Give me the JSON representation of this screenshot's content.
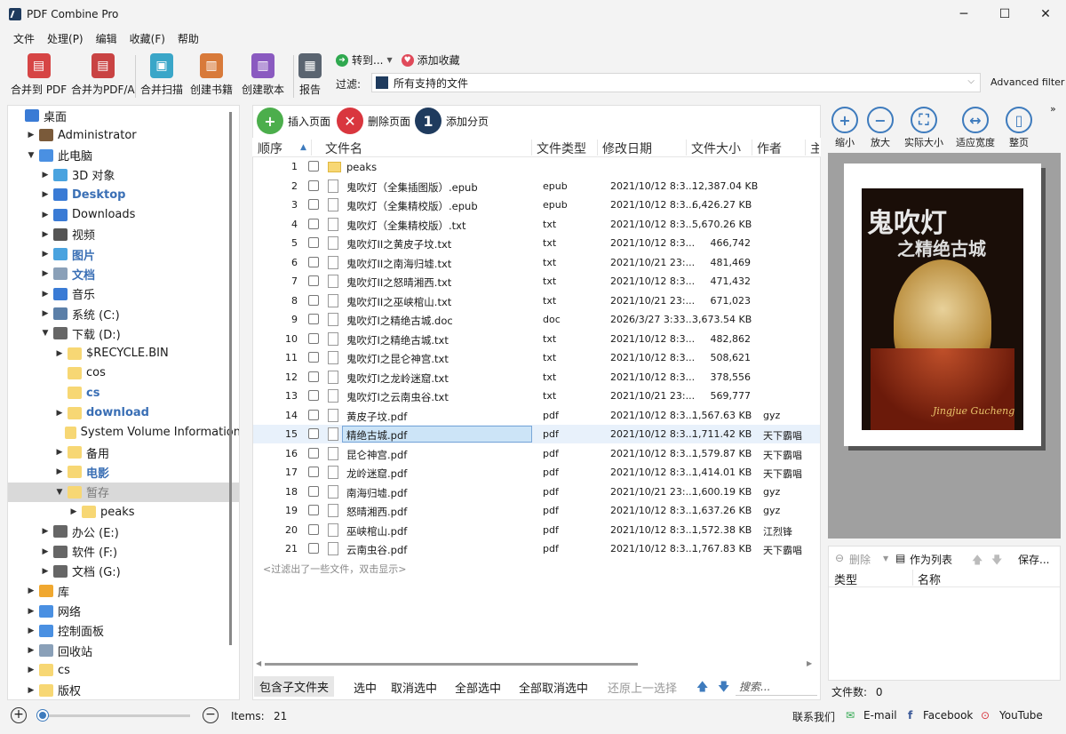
{
  "window": {
    "title": "PDF Combine Pro",
    "min": "─",
    "max": "☐",
    "close": "✕"
  },
  "menu": [
    "文件",
    "处理(P)",
    "编辑",
    "收藏(F)",
    "帮助"
  ],
  "toolbar": {
    "buttons": [
      "合并到 PDF",
      "合并为PDF/A",
      "合并扫描",
      "创建书籍",
      "创建歌本",
      "报告"
    ],
    "goto_label": "转到...",
    "favorite_label": "添加收藏",
    "filter_label": "过滤:",
    "filter_value": "所有支持的文件",
    "advanced_filter": "Advanced filter"
  },
  "tree": [
    {
      "label": "桌面",
      "level": 0,
      "twisty": "",
      "icon": "#3a7bd5"
    },
    {
      "label": "Administrator",
      "level": 1,
      "twisty": "▶",
      "icon": "#7a5a3a"
    },
    {
      "label": "此电脑",
      "level": 1,
      "twisty": "▼",
      "icon": "#4a90e2"
    },
    {
      "label": "3D 对象",
      "level": 2,
      "twisty": "▶",
      "icon": "#4aa3df"
    },
    {
      "label": "Desktop",
      "level": 2,
      "twisty": "▶",
      "icon": "#3a7bd5",
      "bold": true
    },
    {
      "label": "Downloads",
      "level": 2,
      "twisty": "▶",
      "icon": "#3a7bd5"
    },
    {
      "label": "视频",
      "level": 2,
      "twisty": "▶",
      "icon": "#555555"
    },
    {
      "label": "图片",
      "level": 2,
      "twisty": "▶",
      "icon": "#4aa3df",
      "bold": true
    },
    {
      "label": "文档",
      "level": 2,
      "twisty": "▶",
      "icon": "#8aa0b8",
      "bold": true
    },
    {
      "label": "音乐",
      "level": 2,
      "twisty": "▶",
      "icon": "#3a7bd5"
    },
    {
      "label": "系统 (C:)",
      "level": 2,
      "twisty": "▶",
      "icon": "#5b7fa8"
    },
    {
      "label": "下载 (D:)",
      "level": 2,
      "twisty": "▼",
      "icon": "#666666"
    },
    {
      "label": "$RECYCLE.BIN",
      "level": 3,
      "twisty": "▶",
      "icon": "#f7d774"
    },
    {
      "label": "cos",
      "level": 3,
      "twisty": "",
      "icon": "#f7d774"
    },
    {
      "label": "cs",
      "level": 3,
      "twisty": "",
      "icon": "#f7d774",
      "bold": true
    },
    {
      "label": "download",
      "level": 3,
      "twisty": "▶",
      "icon": "#f7d774",
      "bold": true
    },
    {
      "label": "System Volume Information",
      "level": 3,
      "twisty": "",
      "icon": "#f7d774"
    },
    {
      "label": "备用",
      "level": 3,
      "twisty": "▶",
      "icon": "#f7d774"
    },
    {
      "label": "电影",
      "level": 3,
      "twisty": "▶",
      "icon": "#f7d774",
      "bold": true
    },
    {
      "label": "暂存",
      "level": 3,
      "twisty": "▼",
      "icon": "#f7d774",
      "selected": true
    },
    {
      "label": "peaks",
      "level": 4,
      "twisty": "▶",
      "icon": "#f7d774"
    },
    {
      "label": "办公 (E:)",
      "level": 2,
      "twisty": "▶",
      "icon": "#666666"
    },
    {
      "label": "软件 (F:)",
      "level": 2,
      "twisty": "▶",
      "icon": "#666666"
    },
    {
      "label": "文档 (G:)",
      "level": 2,
      "twisty": "▶",
      "icon": "#666666"
    },
    {
      "label": "库",
      "level": 1,
      "twisty": "▶",
      "icon": "#f0a830"
    },
    {
      "label": "网络",
      "level": 1,
      "twisty": "▶",
      "icon": "#4a90e2"
    },
    {
      "label": "控制面板",
      "level": 1,
      "twisty": "▶",
      "icon": "#4a90e2"
    },
    {
      "label": "回收站",
      "level": 1,
      "twisty": "▶",
      "icon": "#8aa0b8"
    },
    {
      "label": "cs",
      "level": 1,
      "twisty": "▶",
      "icon": "#f7d774"
    },
    {
      "label": "版权",
      "level": 1,
      "twisty": "▶",
      "icon": "#f7d774"
    }
  ],
  "page_buttons": {
    "insert": "插入页面",
    "delete": "删除页面",
    "add_section": "添加分页"
  },
  "columns": [
    "顺序",
    "文件名",
    "文件类型",
    "修改日期",
    "文件大小",
    "作者",
    "主"
  ],
  "files": [
    {
      "n": "1",
      "name": "peaks",
      "type": "",
      "date": "",
      "size": "",
      "author": "",
      "folder": true
    },
    {
      "n": "2",
      "name": "鬼吹灯（全集插图版）.epub",
      "type": "epub",
      "date": "2021/10/12 8:3...",
      "size": "12,387.04 KB",
      "author": ""
    },
    {
      "n": "3",
      "name": "鬼吹灯（全集精校版）.epub",
      "type": "epub",
      "date": "2021/10/12 8:3...",
      "size": "6,426.27 KB",
      "author": ""
    },
    {
      "n": "4",
      "name": "鬼吹灯（全集精校版）.txt",
      "type": "txt",
      "date": "2021/10/12 8:3...",
      "size": "5,670.26 KB",
      "author": ""
    },
    {
      "n": "5",
      "name": "鬼吹灯II之黄皮子坟.txt",
      "type": "txt",
      "date": "2021/10/12 8:3...",
      "size": "466,742",
      "author": ""
    },
    {
      "n": "6",
      "name": "鬼吹灯II之南海归墟.txt",
      "type": "txt",
      "date": "2021/10/21 23:...",
      "size": "481,469",
      "author": ""
    },
    {
      "n": "7",
      "name": "鬼吹灯II之怒晴湘西.txt",
      "type": "txt",
      "date": "2021/10/12 8:3...",
      "size": "471,432",
      "author": ""
    },
    {
      "n": "8",
      "name": "鬼吹灯II之巫峡棺山.txt",
      "type": "txt",
      "date": "2021/10/21 23:...",
      "size": "671,023",
      "author": ""
    },
    {
      "n": "9",
      "name": "鬼吹灯I之精绝古城.doc",
      "type": "doc",
      "date": "2026/3/27 3:33...",
      "size": "3,673.54 KB",
      "author": ""
    },
    {
      "n": "10",
      "name": "鬼吹灯I之精绝古城.txt",
      "type": "txt",
      "date": "2021/10/12 8:3...",
      "size": "482,862",
      "author": ""
    },
    {
      "n": "11",
      "name": "鬼吹灯I之昆仑神宫.txt",
      "type": "txt",
      "date": "2021/10/12 8:3...",
      "size": "508,621",
      "author": ""
    },
    {
      "n": "12",
      "name": "鬼吹灯I之龙岭迷窟.txt",
      "type": "txt",
      "date": "2021/10/12 8:3...",
      "size": "378,556",
      "author": ""
    },
    {
      "n": "13",
      "name": "鬼吹灯I之云南虫谷.txt",
      "type": "txt",
      "date": "2021/10/21 23:...",
      "size": "569,777",
      "author": ""
    },
    {
      "n": "14",
      "name": "黄皮子坟.pdf",
      "type": "pdf",
      "date": "2021/10/12 8:3...",
      "size": "1,567.63 KB",
      "author": "gyz"
    },
    {
      "n": "15",
      "name": "精绝古城.pdf",
      "type": "pdf",
      "date": "2021/10/12 8:3...",
      "size": "1,711.42 KB",
      "author": "天下霸唱",
      "selected": true
    },
    {
      "n": "16",
      "name": "昆仑神宫.pdf",
      "type": "pdf",
      "date": "2021/10/12 8:3...",
      "size": "1,579.87 KB",
      "author": "天下霸唱"
    },
    {
      "n": "17",
      "name": "龙岭迷窟.pdf",
      "type": "pdf",
      "date": "2021/10/12 8:3...",
      "size": "1,414.01 KB",
      "author": "天下霸唱"
    },
    {
      "n": "18",
      "name": "南海归墟.pdf",
      "type": "pdf",
      "date": "2021/10/21 23:...",
      "size": "1,600.19 KB",
      "author": "gyz"
    },
    {
      "n": "19",
      "name": "怒晴湘西.pdf",
      "type": "pdf",
      "date": "2021/10/12 8:3...",
      "size": "1,637.26 KB",
      "author": "gyz"
    },
    {
      "n": "20",
      "name": "巫峡棺山.pdf",
      "type": "pdf",
      "date": "2021/10/12 8:3...",
      "size": "1,572.38 KB",
      "author": "江烈锋"
    },
    {
      "n": "21",
      "name": "云南虫谷.pdf",
      "type": "pdf",
      "date": "2021/10/12 8:3...",
      "size": "1,767.83 KB",
      "author": "天下霸唱"
    }
  ],
  "hint": "<过滤出了一些文件，双击显示>",
  "actions": {
    "subfolders": "包含子文件夹",
    "select": "选中",
    "unselect": "取消选中",
    "select_all": "全部选中",
    "unselect_all": "全部取消选中",
    "restore": "还原上一选择",
    "search_placeholder": "搜索..."
  },
  "viewer": {
    "zoom_out": "缩小",
    "zoom_in": "放大",
    "actual": "实际大小",
    "fit_width": "适应宽度",
    "whole_page": "整页"
  },
  "cover": {
    "title": "鬼吹灯",
    "subtitle": "之精绝古城",
    "latin": "Jingjue Gucheng"
  },
  "bookmarks": {
    "delete": "删除",
    "as_list": "作为列表",
    "save": "保存...",
    "col_type": "类型",
    "col_name": "名称",
    "file_count_label": "文件数:",
    "file_count": "0"
  },
  "status": {
    "items_label": "Items:",
    "items": "21",
    "contact": "联系我们",
    "email": "E-mail",
    "facebook": "Facebook",
    "youtube": "YouTube"
  }
}
